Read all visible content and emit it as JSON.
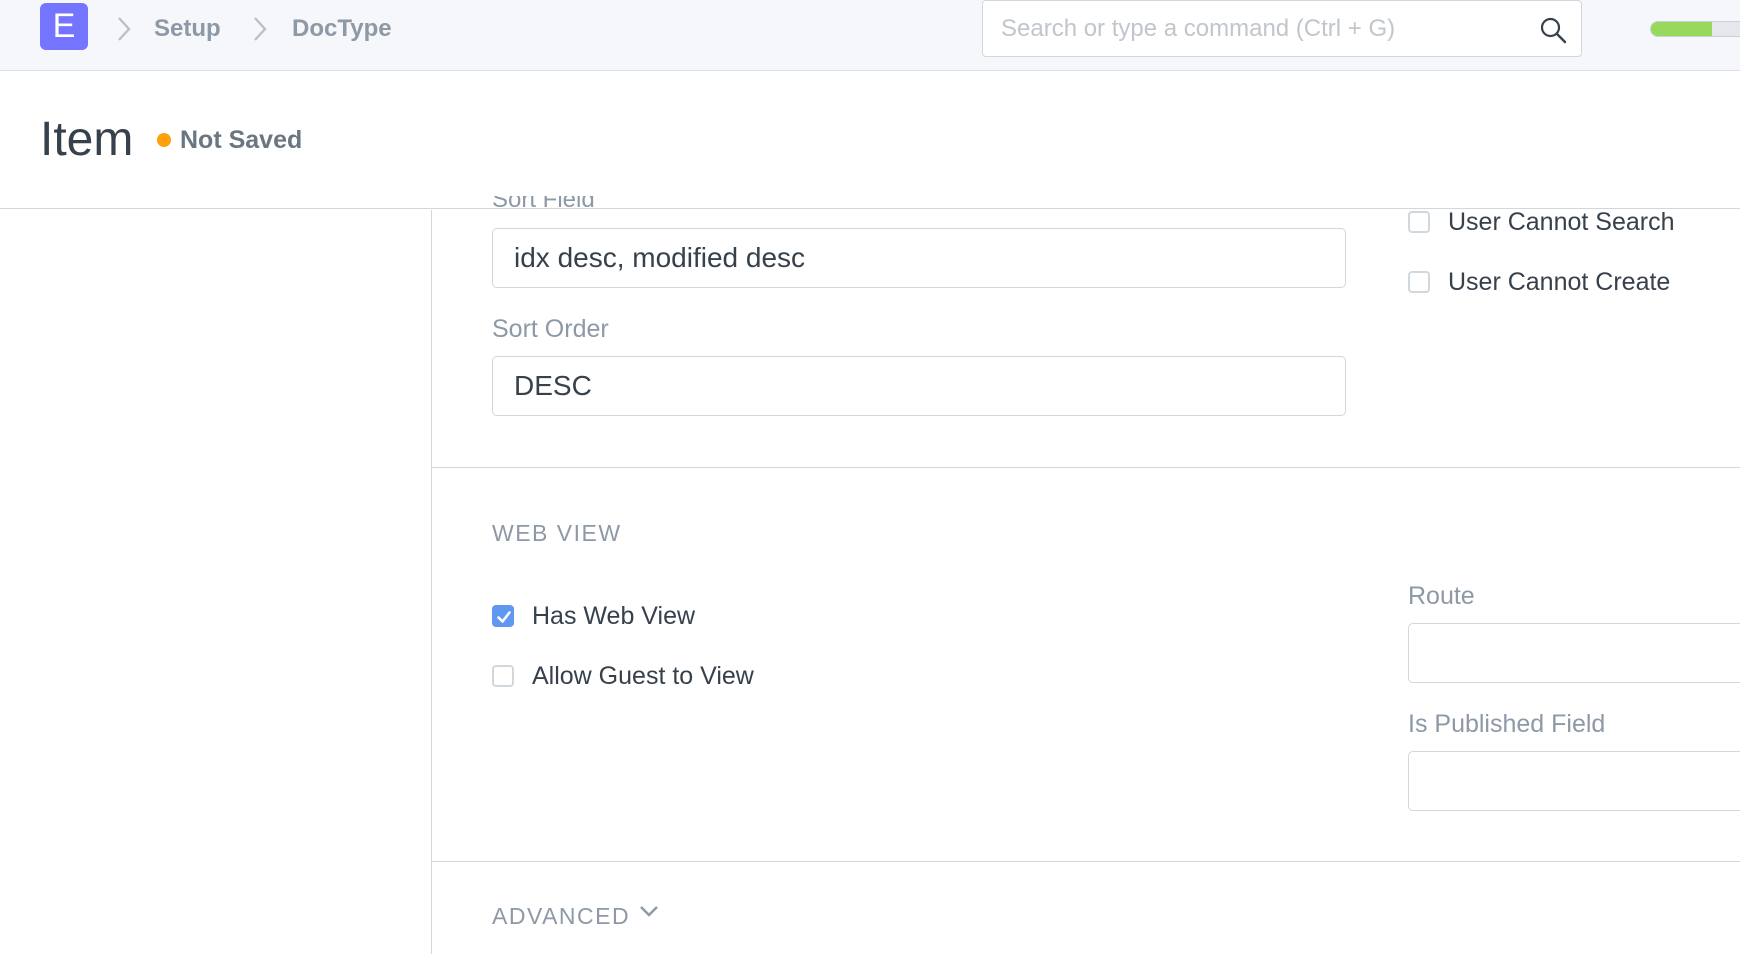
{
  "navbar": {
    "logo_letter": "E",
    "breadcrumbs": [
      "Setup",
      "DocType"
    ],
    "search_placeholder": "Search or type a command (Ctrl + G)",
    "progress": 0.62,
    "accent_color": "#7574ff"
  },
  "page": {
    "title": "Item",
    "status": "Not Saved",
    "status_color": "#ffa00a"
  },
  "form": {
    "sort_field_value": "idx desc, modified desc",
    "sort_order_label": "Sort Order",
    "sort_order_value": "DESC",
    "permissions": [
      {
        "label": "User Cannot Search",
        "checked": false
      },
      {
        "label": "User Cannot Create",
        "checked": false
      }
    ],
    "web_view": {
      "heading": "WEB VIEW",
      "has_web_view": {
        "label": "Has Web View",
        "checked": true
      },
      "allow_guest": {
        "label": "Allow Guest to View",
        "checked": false
      },
      "route_label": "Route",
      "route_value": "",
      "is_published_label": "Is Published Field",
      "is_published_value": ""
    },
    "advanced": {
      "heading": "ADVANCED",
      "icon": "chevron-down-icon"
    }
  }
}
